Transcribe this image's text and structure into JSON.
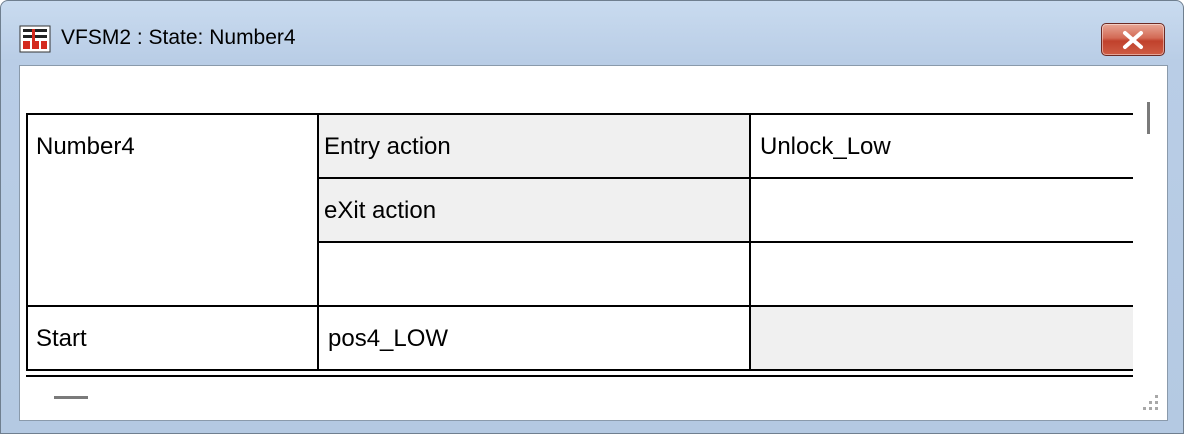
{
  "window": {
    "title": "VFSM2 : State: Number4",
    "close_glyph": "x"
  },
  "state_table": {
    "rows": [
      {
        "state": "Number4",
        "type": "Entry action",
        "value": "Unlock_Low"
      },
      {
        "state": "",
        "type": "eXit action",
        "value": ""
      },
      {
        "state": "",
        "type": "",
        "value": ""
      },
      {
        "state": "Start",
        "type": "pos4_LOW",
        "value": ""
      }
    ]
  },
  "icons": {
    "app": "vfsm-app-icon",
    "close": "close-icon",
    "resize": "size-grip-icon"
  },
  "colors": {
    "title_bar": "#c9dbef",
    "close_button": "#c9452f",
    "cell_gray": "#f0f0f0"
  }
}
